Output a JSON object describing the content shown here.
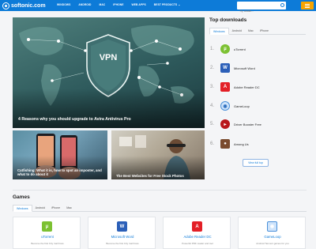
{
  "header": {
    "logo_text": "softonic.com",
    "nav": [
      "WINDOWS",
      "ANDROID",
      "MAC",
      "IPHONE",
      "WEB APPS",
      "BEST PRODUCTS ⌄"
    ],
    "search_placeholder": "Try astalo..."
  },
  "hero": {
    "badge": "VPN",
    "title": "4 Reasons why you should upgrade to Avira Antivirus Pro"
  },
  "articles": [
    {
      "title": "Catfishing: What it is, how to spot an imposter, and what to do about it"
    },
    {
      "title": "The Best Websites for Free Stock Photos"
    }
  ],
  "top_downloads": {
    "heading": "Top downloads",
    "tabs": [
      "Windows",
      "Android",
      "Mac",
      "iPhone"
    ],
    "items": [
      {
        "rank": "1.",
        "name": "uTorrent",
        "icon": "utorrent-icon"
      },
      {
        "rank": "2.",
        "name": "Microsoft Word",
        "icon": "word-icon"
      },
      {
        "rank": "3.",
        "name": "Adobe Reader DC",
        "icon": "pdf-icon"
      },
      {
        "rank": "4.",
        "name": "GameLoop",
        "icon": "gameloop-icon"
      },
      {
        "rank": "5.",
        "name": "Driver Booster Free",
        "icon": "driver-booster-icon"
      },
      {
        "rank": "6.",
        "name": "Among Us",
        "icon": "among-us-icon"
      }
    ],
    "view_all": "View full top"
  },
  "games": {
    "heading": "Games",
    "tabs": [
      "Windows",
      "Android",
      "iPhone",
      "Mac"
    ],
    "cards": [
      {
        "name": "uTorrent",
        "desc": "Become the first City mail boss"
      },
      {
        "name": "Microsoft Word",
        "desc": "Become the first City mail boss"
      },
      {
        "name": "Adobe Reader DC",
        "desc": "Powerful PDF reader and tool"
      },
      {
        "name": "GameLoop",
        "desc": "Android Tencent games for you"
      }
    ]
  },
  "colors": {
    "brand_blue": "#0d7bd8",
    "menu_orange": "#f7a400"
  }
}
